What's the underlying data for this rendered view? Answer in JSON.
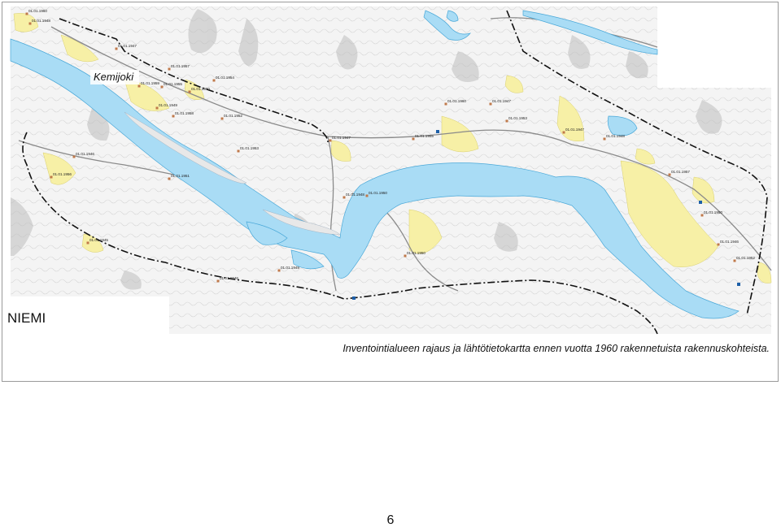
{
  "map": {
    "river_name": "Kemijoki",
    "place_name": "NIEMI",
    "colors": {
      "water": "#a9dcf5",
      "water_edge": "#4aa8d8",
      "building_area": "#f7f0a6",
      "terrain_line": "#c8c8c8",
      "boundary": "#111111"
    },
    "sites": [
      {
        "label": "01.01.1960"
      },
      {
        "label": "01.01.1948"
      },
      {
        "label": "01.01.1947"
      },
      {
        "label": "01.01.1957"
      },
      {
        "label": "01.01.1959"
      },
      {
        "label": "01.01.1954"
      },
      {
        "label": "01.01.1950"
      },
      {
        "label": "01.01.1955"
      },
      {
        "label": "01.01.1949"
      },
      {
        "label": "01.01.1958"
      },
      {
        "label": "01.01.1952"
      },
      {
        "label": "01.01.1946"
      },
      {
        "label": "01.01.1953"
      },
      {
        "label": "01.01.1956"
      },
      {
        "label": "01.01.1951"
      },
      {
        "label": "01.01.1947"
      },
      {
        "label": "01.01.1945"
      },
      {
        "label": "01.01.1949"
      },
      {
        "label": "01.01.1946"
      },
      {
        "label": "01.01.1948"
      },
      {
        "label": "01.01.1950"
      },
      {
        "label": "01.01.1955"
      },
      {
        "label": "01.01.1960"
      },
      {
        "label": "01.01.1947"
      },
      {
        "label": "01.01.1953"
      },
      {
        "label": "01.01.1957"
      },
      {
        "label": "01.01.1950"
      },
      {
        "label": "01.01.1947"
      },
      {
        "label": "01.01.1948"
      },
      {
        "label": "01.01.1950"
      },
      {
        "label": "01.01.1946"
      },
      {
        "label": "01.01.1952"
      }
    ]
  },
  "caption": "Inventointialueen rajaus ja lähtötietokartta ennen vuotta 1960 rakennetuista rakennuskohteista.",
  "page_number": "6"
}
